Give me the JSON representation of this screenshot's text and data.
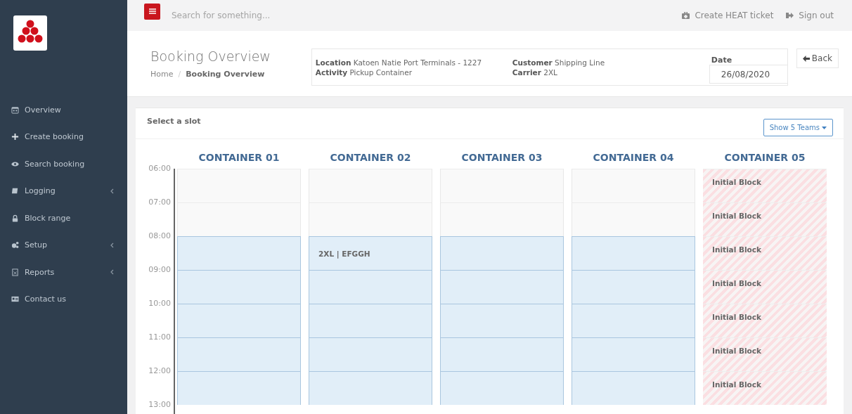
{
  "topbar": {
    "search": {
      "placeholder": "Search for something..."
    },
    "links": [
      {
        "label": "Create HEAT ticket"
      },
      {
        "label": "Sign out"
      }
    ]
  },
  "sidebar": {
    "items": [
      {
        "label": "Overview",
        "submenu": false
      },
      {
        "label": "Create booking",
        "submenu": false
      },
      {
        "label": "Search booking",
        "submenu": false
      },
      {
        "label": "Logging",
        "submenu": true
      },
      {
        "label": "Block range",
        "submenu": false
      },
      {
        "label": "Setup",
        "submenu": true
      },
      {
        "label": "Reports",
        "submenu": true
      },
      {
        "label": "Contact us",
        "submenu": false
      }
    ]
  },
  "header": {
    "title": "Booking Overview",
    "breadcrumb": [
      "Home",
      "/",
      "Booking Overview"
    ],
    "info": [
      "**Location** Katoen Natie Port Terminals - 1227",
      "**Activity** Pickup Container",
      "**Customer** Shipping Line",
      "**Carrier** 2XL"
    ],
    "date": {
      "label": "Date",
      "value": "26/08/2020"
    },
    "back_button": "Back"
  },
  "scheduler": {
    "title": "Select a slot",
    "teams_button": "Show 5 Teams",
    "times": [
      "06:00",
      "07:00",
      "08:00",
      "09:00",
      "10:00",
      "11:00",
      "12:00",
      "13:00"
    ],
    "columns": [
      {
        "name": "CONTAINER 01",
        "slots": [
          {
            "kind": "closed"
          },
          {
            "kind": "closed"
          },
          {
            "kind": "open"
          },
          {
            "kind": "open"
          },
          {
            "kind": "open"
          },
          {
            "kind": "open"
          },
          {
            "kind": "open"
          }
        ]
      },
      {
        "name": "CONTAINER 02",
        "slots": [
          {
            "kind": "closed"
          },
          {
            "kind": "closed"
          },
          {
            "kind": "open",
            "text": "2XL | EFGGH"
          },
          {
            "kind": "open"
          },
          {
            "kind": "open"
          },
          {
            "kind": "open"
          },
          {
            "kind": "open"
          }
        ]
      },
      {
        "name": "CONTAINER 03",
        "slots": [
          {
            "kind": "closed"
          },
          {
            "kind": "closed"
          },
          {
            "kind": "open"
          },
          {
            "kind": "open"
          },
          {
            "kind": "open"
          },
          {
            "kind": "open"
          },
          {
            "kind": "open"
          }
        ]
      },
      {
        "name": "CONTAINER 04",
        "slots": [
          {
            "kind": "closed"
          },
          {
            "kind": "closed"
          },
          {
            "kind": "open"
          },
          {
            "kind": "open"
          },
          {
            "kind": "open"
          },
          {
            "kind": "open"
          },
          {
            "kind": "open"
          }
        ]
      },
      {
        "name": "CONTAINER 05",
        "slots": [
          {
            "kind": "blocked",
            "text": "Initial Block"
          },
          {
            "kind": "blocked",
            "text": "Initial Block"
          },
          {
            "kind": "blocked",
            "text": "Initial Block"
          },
          {
            "kind": "blocked",
            "text": "Initial Block"
          },
          {
            "kind": "blocked",
            "text": "Initial Block"
          },
          {
            "kind": "blocked",
            "text": "Initial Block"
          },
          {
            "kind": "blocked",
            "text": "Initial Block"
          }
        ]
      }
    ]
  }
}
